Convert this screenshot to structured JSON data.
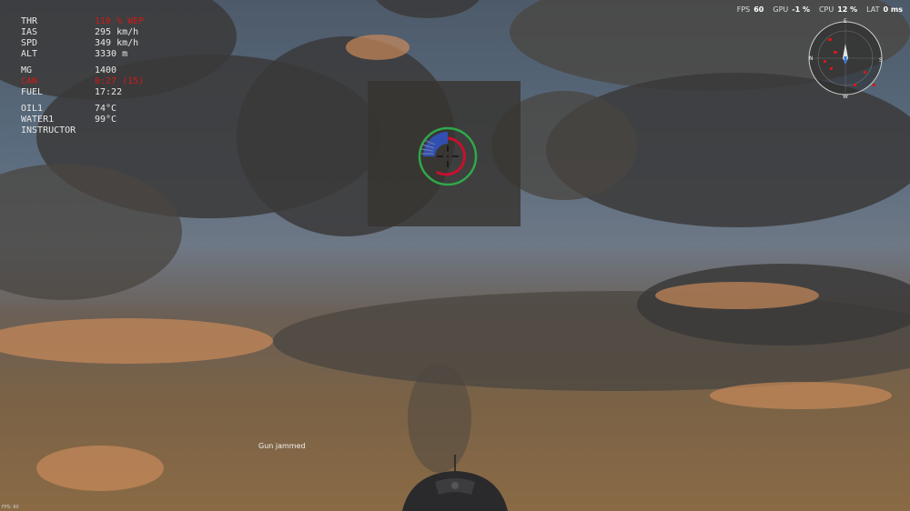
{
  "hud": {
    "thr": {
      "label": "THR",
      "value": "110 % WEP"
    },
    "ias": {
      "label": "IAS",
      "value": "295 km/h"
    },
    "spd": {
      "label": "SPD",
      "value": "349 km/h"
    },
    "alt": {
      "label": "ALT",
      "value": "3330 m"
    },
    "mg": {
      "label": "MG",
      "value": "1400"
    },
    "can": {
      "label": "CAN",
      "value": "0:27 (15)"
    },
    "fuel": {
      "label": "FUEL",
      "value": "17:22"
    },
    "oil": {
      "label": "OIL1",
      "value": "74°C"
    },
    "water": {
      "label": "WATER1",
      "value": "99°C"
    },
    "instructor": {
      "label": "INSTRUCTOR"
    }
  },
  "perf": {
    "fps": {
      "label": "FPS",
      "value": "60"
    },
    "gpu": {
      "label": "GPU",
      "value": "-1 %"
    },
    "cpu": {
      "label": "CPU",
      "value": "12 %"
    },
    "lat": {
      "label": "LAT",
      "value": "0 ms"
    }
  },
  "compass": {
    "n": "N",
    "e": "E",
    "s": "S",
    "w": "W"
  },
  "message": "Gun jammed",
  "fps_mini": "FPS: 60",
  "colors": {
    "warning": "#d11a1a",
    "sight_ring": "#2fa84a",
    "sight_arc": "#c8102e",
    "sight_fill": "#2f55c8"
  }
}
